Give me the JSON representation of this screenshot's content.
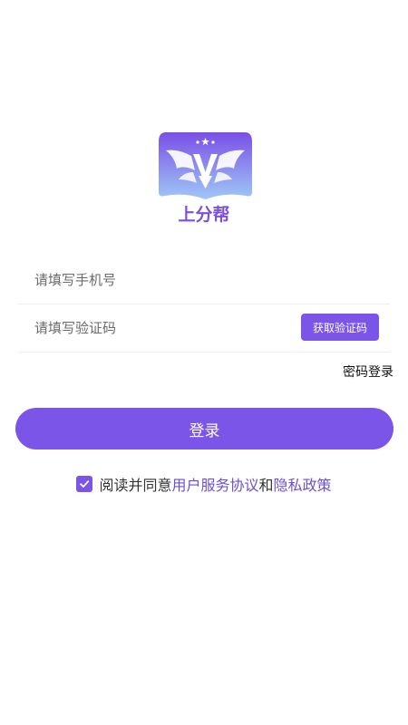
{
  "brand": {
    "name": "上分帮",
    "accent_color": "#7b55e8"
  },
  "form": {
    "phone_placeholder": "请填写手机号",
    "code_placeholder": "请填写验证码",
    "get_code_label": "获取验证码",
    "password_login_label": "密码登录",
    "login_label": "登录"
  },
  "agreement": {
    "checked": true,
    "prefix": "阅读并同意",
    "terms_link": "用户服务协议",
    "conjunction": "和",
    "privacy_link": "隐私政策"
  },
  "icons": {
    "logo": "winged-shield-logo",
    "checkbox": "check-icon"
  }
}
